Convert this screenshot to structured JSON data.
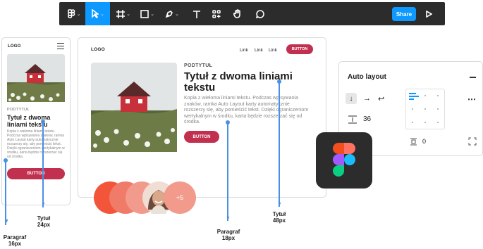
{
  "toolbar": {
    "share_label": "Share"
  },
  "mobile": {
    "logo": "LOGO",
    "subtitle": "PODTYTUŁ",
    "title": "Tytuł z dwoma liniami tekstu",
    "paragraph": "Kopia z wieloma liniami tekstu. Podczas wpisywania znaków, ramka Auto Layout karty automatycznie rozszerzy się, aby pomieścić tekst. Dzięki ograniczeniom wertykalnym w środku, karta będzie rozszerzać się od środka.",
    "button": "BUTTON"
  },
  "desktop": {
    "logo": "LOGO",
    "links": [
      "Link",
      "Link",
      "Link"
    ],
    "nav_button": "BUTTON",
    "subtitle": "PODTYTUŁ",
    "title": "Tytuł z dwoma liniami tekstu",
    "paragraph": "Kopia z wieloma liniami tekstu. Podczas wpisywania znaków, ramka Auto Layout karty automatycznie rozszerzy się, aby pomieścić tekst. Dzięki ograniczeniom wertykalnym w środku, karta będzie rozszerzać się od środka.",
    "button": "BUTTON"
  },
  "avatars": {
    "more_label": "+5"
  },
  "auto_layout": {
    "title": "Auto layout",
    "spacing_value": "36",
    "padding_value": "0"
  },
  "annotations": {
    "paragraph_16": [
      "Paragraf",
      "16px"
    ],
    "title_24": [
      "Tytuł",
      "24px"
    ],
    "paragraph_18": [
      "Paragraf",
      "18px"
    ],
    "title_48": [
      "Tytuł",
      "48px"
    ]
  },
  "colors": {
    "accent": "#0d99ff",
    "button_red": "#c1304e",
    "annotation_blue": "#4a90e2",
    "toolbar_bg": "#2c2c2c"
  }
}
